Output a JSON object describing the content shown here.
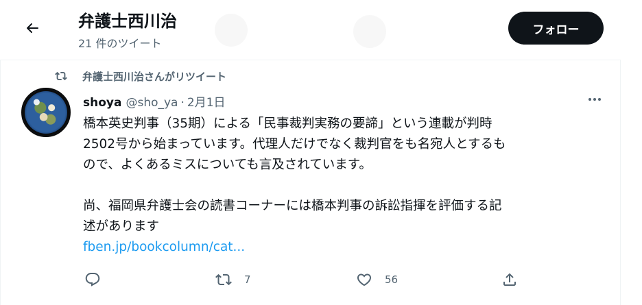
{
  "header": {
    "back_label": "back",
    "title": "弁護士西川治",
    "tweet_count": "21 件のツイート",
    "follow_label": "フォロー"
  },
  "retweet_context": {
    "text": "弁護士西川治さんがリツイート"
  },
  "tweet": {
    "author_name": "shoya",
    "author_handle": "@sho_ya",
    "dot": "·",
    "date": "2月1日",
    "lines": [
      "橋本英史判事（35期）による「民事裁判実務の要諦」という連載が判時",
      "2502号から始まっています。代理人だけでなく裁判官をも名宛人とするも",
      "ので、よくあるミスについても言及されています。",
      "",
      "尚、福岡県弁護士会の読書コーナーには橋本判事の訴訟指揮を評価する記",
      "述があります"
    ],
    "link_text": "fben.jp/bookcolumn/cat..."
  },
  "actions": {
    "reply_count": "",
    "retweet_count": "7",
    "like_count": "56"
  },
  "icons": {
    "back": "arrow-left-icon",
    "retweet": "retweet-icon",
    "more": "more-horizontal-icon",
    "reply": "reply-icon",
    "like": "heart-icon",
    "share": "share-icon"
  },
  "colors": {
    "text": "#0f1419",
    "secondary": "#536471",
    "link": "#1d9bf0",
    "follow_bg": "#0f1419",
    "divider": "#eff3f4"
  }
}
